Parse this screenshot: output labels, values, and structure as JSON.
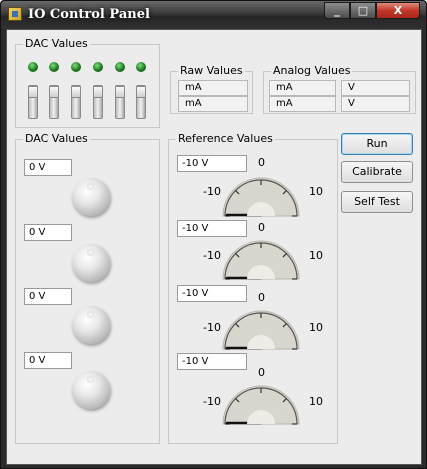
{
  "window": {
    "title": "IO Control Panel",
    "icon": "app-icon"
  },
  "window_controls": {
    "minimize": "_",
    "maximize": "□",
    "close": "X"
  },
  "dac_switches": {
    "label": "DAC Values",
    "count": 6,
    "led_color": "#2fa82f"
  },
  "raw_values": {
    "label": "Raw Values",
    "rows": [
      "mA",
      "mA"
    ]
  },
  "analog_values": {
    "label": "Analog Values",
    "rows": [
      [
        "mA",
        "V"
      ],
      [
        "mA",
        "V"
      ]
    ]
  },
  "dac_values": {
    "label": "DAC Values",
    "fields": [
      "0 V",
      "0 V",
      "0 V",
      "0 V"
    ]
  },
  "reference_values": {
    "label": "Reference Values",
    "gauges": [
      {
        "field": "-10 V",
        "min": "-10",
        "mid": "0",
        "max": "10",
        "value": -10
      },
      {
        "field": "-10 V",
        "min": "-10",
        "mid": "0",
        "max": "10",
        "value": -10
      },
      {
        "field": "-10 V",
        "min": "-10",
        "mid": "0",
        "max": "10",
        "value": -10
      },
      {
        "field": "-10 V",
        "min": "-10",
        "mid": "0",
        "max": "10",
        "value": -10
      }
    ]
  },
  "buttons": {
    "run": "Run",
    "calibrate": "Calibrate",
    "self_test": "Self Test"
  }
}
